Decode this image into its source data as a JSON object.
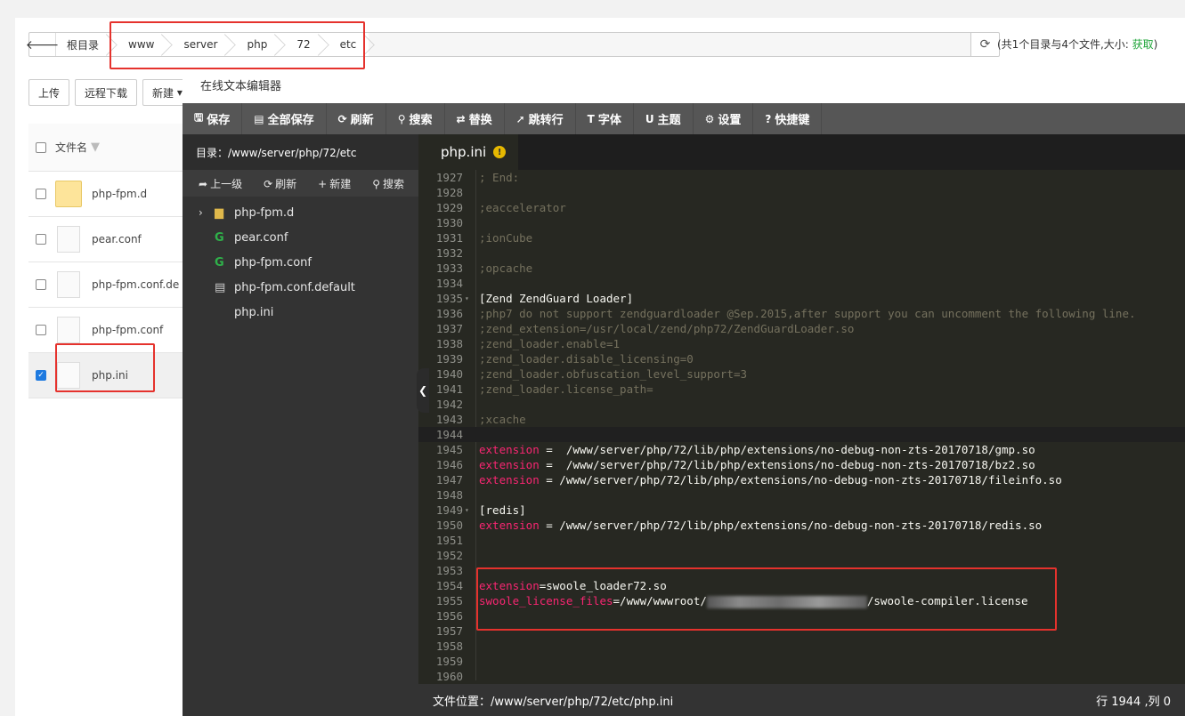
{
  "file_manager": {
    "back_icon": "arrow-left-icon",
    "breadcrumbs": [
      "根目录",
      "www",
      "server",
      "php",
      "72",
      "etc"
    ],
    "refresh_icon": "refresh-icon",
    "info_prefix": "(共1个目录与4个文件,大小: ",
    "info_link": "获取",
    "info_suffix": ")",
    "buttons": [
      "上传",
      "远程下载",
      "新建"
    ],
    "column_header": "文件名",
    "files": [
      {
        "name": "php-fpm.d",
        "type": "folder",
        "checked": false
      },
      {
        "name": "pear.conf",
        "type": "file",
        "checked": false
      },
      {
        "name": "php-fpm.conf.de",
        "type": "file",
        "checked": false
      },
      {
        "name": "php-fpm.conf",
        "type": "file",
        "checked": false
      },
      {
        "name": "php.ini",
        "type": "file",
        "checked": true
      }
    ]
  },
  "editor": {
    "title": "在线文本编辑器",
    "toolbar": [
      {
        "icon": "save-icon",
        "glyph": "🖫",
        "label": "保存"
      },
      {
        "icon": "save-all-icon",
        "glyph": "▤",
        "label": "全部保存"
      },
      {
        "icon": "refresh-icon",
        "glyph": "⟳",
        "label": "刷新"
      },
      {
        "icon": "search-icon",
        "glyph": "⚲",
        "label": "搜索"
      },
      {
        "icon": "replace-icon",
        "glyph": "⇄",
        "label": "替换"
      },
      {
        "icon": "goto-line-icon",
        "glyph": "➚",
        "label": "跳转行"
      },
      {
        "icon": "font-icon",
        "glyph": "T",
        "label": "字体"
      },
      {
        "icon": "theme-icon",
        "glyph": "U",
        "label": "主题"
      },
      {
        "icon": "settings-icon",
        "glyph": "⚙",
        "label": "设置"
      },
      {
        "icon": "help-icon",
        "glyph": "?",
        "label": "快捷键"
      }
    ],
    "sidebar": {
      "dir_label": "目录：/www/server/php/72/etc",
      "tools": [
        {
          "icon": "up-level-icon",
          "glyph": "➦",
          "label": "上一级"
        },
        {
          "icon": "refresh-icon",
          "glyph": "⟳",
          "label": "刷新"
        },
        {
          "icon": "plus-icon",
          "glyph": "+",
          "label": "新建"
        },
        {
          "icon": "search-icon",
          "glyph": "⚲",
          "label": "搜索"
        }
      ],
      "tree": [
        {
          "name": "php-fpm.d",
          "icon": "folder-icon",
          "glyph": "▆",
          "cls": "ti-folder",
          "arrow": "›"
        },
        {
          "name": "pear.conf",
          "icon": "config-file-icon",
          "glyph": "G",
          "cls": "ti-g",
          "arrow": ""
        },
        {
          "name": "php-fpm.conf",
          "icon": "config-file-icon",
          "glyph": "G",
          "cls": "ti-g",
          "arrow": ""
        },
        {
          "name": "php-fpm.conf.default",
          "icon": "document-icon",
          "glyph": "▤",
          "cls": "ti-doc",
          "arrow": ""
        },
        {
          "name": "php.ini",
          "icon": "",
          "glyph": "",
          "cls": "",
          "arrow": ""
        }
      ]
    },
    "tab": {
      "name": "php.ini",
      "warning_icon": "warning-icon",
      "warning_glyph": "!"
    },
    "active_line": 1944,
    "code_lines": [
      {
        "n": 1927,
        "fold": "",
        "parts": [
          [
            "cm",
            "; End:"
          ]
        ]
      },
      {
        "n": 1928,
        "fold": "",
        "parts": []
      },
      {
        "n": 1929,
        "fold": "",
        "parts": [
          [
            "cm",
            ";eaccelerator"
          ]
        ]
      },
      {
        "n": 1930,
        "fold": "",
        "parts": []
      },
      {
        "n": 1931,
        "fold": "",
        "parts": [
          [
            "cm",
            ";ionCube"
          ]
        ]
      },
      {
        "n": 1932,
        "fold": "",
        "parts": []
      },
      {
        "n": 1933,
        "fold": "",
        "parts": [
          [
            "cm",
            ";opcache"
          ]
        ]
      },
      {
        "n": 1934,
        "fold": "",
        "parts": []
      },
      {
        "n": 1935,
        "fold": "▾",
        "parts": [
          [
            "pl",
            "[Zend ZendGuard Loader]"
          ]
        ]
      },
      {
        "n": 1936,
        "fold": "",
        "parts": [
          [
            "cm",
            ";php7 do not support zendguardloader @Sep.2015,after support you can uncomment the following line."
          ]
        ]
      },
      {
        "n": 1937,
        "fold": "",
        "parts": [
          [
            "cm",
            ";zend_extension=/usr/local/zend/php72/ZendGuardLoader.so"
          ]
        ]
      },
      {
        "n": 1938,
        "fold": "",
        "parts": [
          [
            "cm",
            ";zend_loader.enable=1"
          ]
        ]
      },
      {
        "n": 1939,
        "fold": "",
        "parts": [
          [
            "cm",
            ";zend_loader.disable_licensing=0"
          ]
        ]
      },
      {
        "n": 1940,
        "fold": "",
        "parts": [
          [
            "cm",
            ";zend_loader.obfuscation_level_support=3"
          ]
        ]
      },
      {
        "n": 1941,
        "fold": "",
        "parts": [
          [
            "cm",
            ";zend_loader.license_path="
          ]
        ]
      },
      {
        "n": 1942,
        "fold": "",
        "parts": []
      },
      {
        "n": 1943,
        "fold": "",
        "parts": [
          [
            "cm",
            ";xcache"
          ]
        ]
      },
      {
        "n": 1944,
        "fold": "",
        "parts": []
      },
      {
        "n": 1945,
        "fold": "",
        "parts": [
          [
            "kw",
            "extension"
          ],
          [
            "pl",
            " =  /www/server/php/72/lib/php/extensions/no-debug-non-zts-20170718/gmp.so"
          ]
        ]
      },
      {
        "n": 1946,
        "fold": "",
        "parts": [
          [
            "kw",
            "extension"
          ],
          [
            "pl",
            " =  /www/server/php/72/lib/php/extensions/no-debug-non-zts-20170718/bz2.so"
          ]
        ]
      },
      {
        "n": 1947,
        "fold": "",
        "parts": [
          [
            "kw",
            "extension"
          ],
          [
            "pl",
            " = /www/server/php/72/lib/php/extensions/no-debug-non-zts-20170718/fileinfo.so"
          ]
        ]
      },
      {
        "n": 1948,
        "fold": "",
        "parts": []
      },
      {
        "n": 1949,
        "fold": "▾",
        "parts": [
          [
            "pl",
            "[redis]"
          ]
        ]
      },
      {
        "n": 1950,
        "fold": "",
        "parts": [
          [
            "kw",
            "extension"
          ],
          [
            "pl",
            " = /www/server/php/72/lib/php/extensions/no-debug-non-zts-20170718/redis.so"
          ]
        ]
      },
      {
        "n": 1951,
        "fold": "",
        "parts": []
      },
      {
        "n": 1952,
        "fold": "",
        "parts": []
      },
      {
        "n": 1953,
        "fold": "",
        "parts": []
      },
      {
        "n": 1954,
        "fold": "",
        "parts": [
          [
            "kw",
            "extension"
          ],
          [
            "pl",
            "=swoole_loader72.so"
          ]
        ]
      },
      {
        "n": 1955,
        "fold": "",
        "parts": [
          [
            "kw",
            "swoole_license_files"
          ],
          [
            "pl",
            "=/www/wwwroot/"
          ],
          [
            "blur",
            ""
          ],
          [
            "pl",
            "/swoole-compiler.license"
          ]
        ]
      },
      {
        "n": 1956,
        "fold": "",
        "parts": []
      },
      {
        "n": 1957,
        "fold": "",
        "parts": []
      },
      {
        "n": 1958,
        "fold": "",
        "parts": []
      },
      {
        "n": 1959,
        "fold": "",
        "parts": []
      },
      {
        "n": 1960,
        "fold": "",
        "parts": []
      }
    ],
    "status": {
      "path": "文件位置：/www/server/php/72/etc/php.ini",
      "cursor": "行 1944 ,列 0"
    },
    "collapse_icon": "chevron-left-icon"
  },
  "colors": {
    "highlight": "#e5322d",
    "keyword": "#f92672",
    "comment": "#75715e",
    "editor_bg": "#272822"
  }
}
